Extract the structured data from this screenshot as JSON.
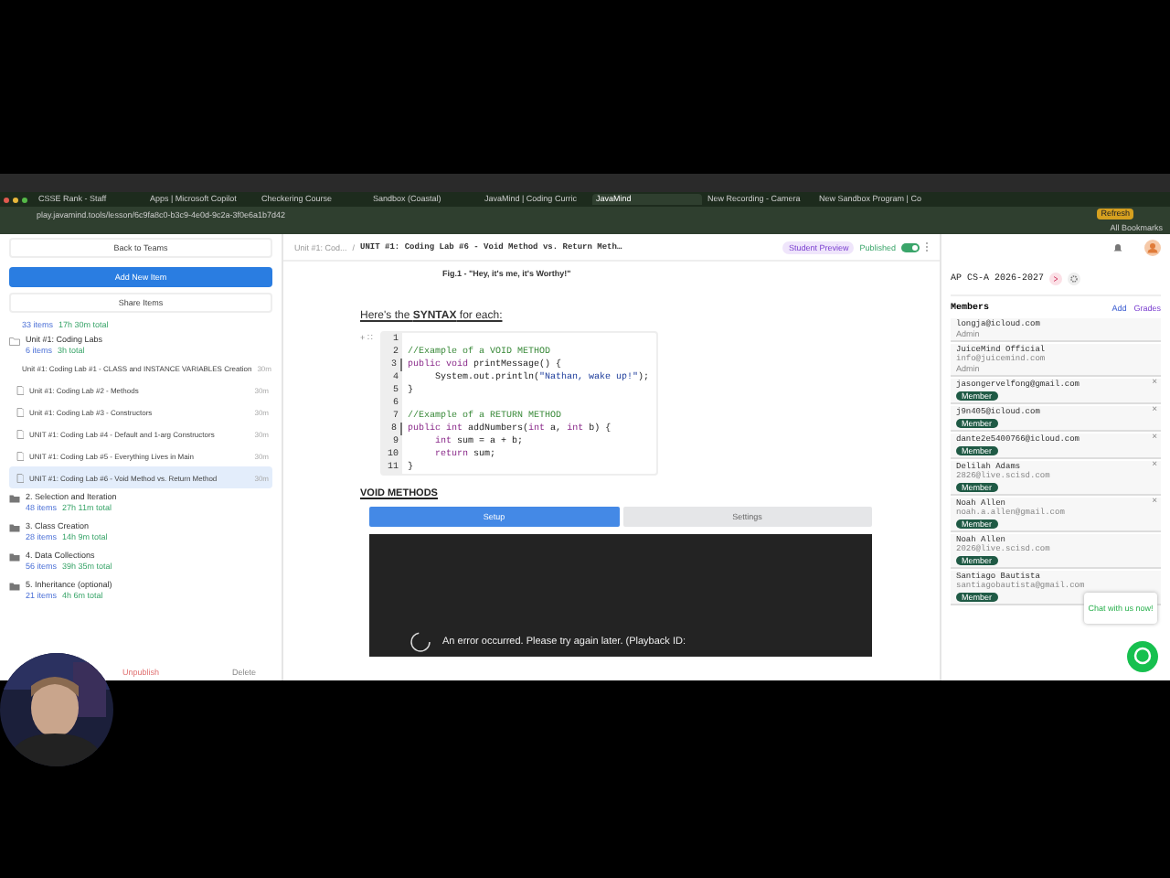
{
  "browser": {
    "tabs": [
      {
        "label": "CSSE Rank - Staff",
        "selected": false
      },
      {
        "label": "Apps | Microsoft Copilot",
        "selected": false
      },
      {
        "label": "Checkering Course",
        "selected": false
      },
      {
        "label": "Sandbox (Coastal)",
        "selected": false
      },
      {
        "label": "JavaMind | Coding Curric",
        "selected": false
      },
      {
        "label": "JavaMind",
        "selected": true
      },
      {
        "label": "New Recording - Camera",
        "selected": false
      },
      {
        "label": "New Sandbox Program | Co",
        "selected": false
      }
    ],
    "address": "play.javamind.tools/lesson/6c9fa8c0-b3c9-4e0d-9c2a-3f0e6a1b7d42",
    "profile": "Refresh",
    "bookmarks": "All Bookmarks"
  },
  "sidebar": {
    "back": "Back to Teams",
    "add": "Add New Item",
    "share": "Share Items",
    "summary": {
      "count": "33 items",
      "total": "17h 30m total"
    },
    "folders": [
      {
        "title": "Unit #1: Coding Labs",
        "count": "6 items",
        "total": "3h total",
        "expanded": true,
        "children": [
          {
            "title": "Unit #1: Coding Lab #1 - CLASS and INSTANCE VARIABLES Creation",
            "duration": "30m",
            "selected": false
          },
          {
            "title": "Unit #1: Coding Lab #2 - Methods",
            "duration": "30m",
            "selected": false
          },
          {
            "title": "Unit #1: Coding Lab #3 - Constructors",
            "duration": "30m",
            "selected": false
          },
          {
            "title": "UNIT #1: Coding Lab #4 - Default and 1-arg Constructors",
            "duration": "30m",
            "selected": false
          },
          {
            "title": "UNIT #1: Coding Lab #5 - Everything Lives in Main",
            "duration": "30m",
            "selected": false
          },
          {
            "title": "UNIT #1: Coding Lab #6 - Void Method vs. Return Method",
            "duration": "30m",
            "selected": true
          }
        ]
      },
      {
        "title": "2. Selection and Iteration",
        "count": "48 items",
        "total": "27h 11m total",
        "expanded": false
      },
      {
        "title": "3. Class Creation",
        "count": "28 items",
        "total": "14h 9m total",
        "expanded": false
      },
      {
        "title": "4. Data Collections",
        "count": "56 items",
        "total": "39h 35m total",
        "expanded": false
      },
      {
        "title": "5. Inheritance (optional)",
        "count": "21 items",
        "total": "4h 6m total",
        "expanded": false
      }
    ],
    "footer": [
      "Unpublish",
      "Delete"
    ]
  },
  "main": {
    "header": {
      "parent": "Unit #1: Cod...",
      "separator": "/",
      "title": "UNIT #1: Coding Lab #6 - Void Method vs. Return Meth…",
      "preview": "Student Preview",
      "published": "Published",
      "published_on": true
    },
    "caption": "Fig.1 - \"Hey, it's me, it's Worthy!\"",
    "syntax_heading": "Here's the **SYNTAX** for each:",
    "code": [
      {
        "num": "1",
        "fold": false
      },
      {
        "num": "2",
        "fold": false,
        "parts": [
          {
            "kind": "comment",
            "text": "//Example of a VOID METHOD"
          }
        ]
      },
      {
        "num": "3",
        "fold": true,
        "parts": [
          {
            "kind": "keyword",
            "text": "public void "
          },
          {
            "kind": "plain",
            "text": "printMessage() {"
          }
        ]
      },
      {
        "num": "4",
        "fold": false,
        "indented": true,
        "parts": [
          {
            "kind": "plain",
            "text": "System.out.println("
          },
          {
            "kind": "string",
            "text": "\"Nathan, wake up!\""
          },
          {
            "kind": "plain",
            "text": ");"
          }
        ]
      },
      {
        "num": "5",
        "fold": false,
        "parts": [
          {
            "kind": "plain",
            "text": "}"
          }
        ]
      },
      {
        "num": "6",
        "fold": false
      },
      {
        "num": "7",
        "fold": false,
        "parts": [
          {
            "kind": "comment",
            "text": "//Example of a RETURN METHOD"
          }
        ]
      },
      {
        "num": "8",
        "fold": true,
        "parts": [
          {
            "kind": "keyword",
            "text": "public int "
          },
          {
            "kind": "plain",
            "text": "addNumbers("
          },
          {
            "kind": "keyword",
            "text": "int "
          },
          {
            "kind": "plain",
            "text": "a, "
          },
          {
            "kind": "keyword",
            "text": "int "
          },
          {
            "kind": "plain",
            "text": "b) {"
          }
        ]
      },
      {
        "num": "9",
        "fold": false,
        "indented": true,
        "parts": [
          {
            "kind": "keyword",
            "text": "int "
          },
          {
            "kind": "plain",
            "text": "sum = a + b;"
          }
        ]
      },
      {
        "num": "10",
        "fold": false,
        "indented": true,
        "parts": [
          {
            "kind": "keyword",
            "text": "return "
          },
          {
            "kind": "plain",
            "text": "sum;"
          }
        ]
      },
      {
        "num": "11",
        "fold": false,
        "parts": [
          {
            "kind": "plain",
            "text": "}"
          }
        ]
      }
    ],
    "gutter_control": "+ ∷",
    "section_heading": "VOID METHODS",
    "video_tabs": [
      {
        "label": "Setup",
        "selected": true
      },
      {
        "label": "Settings",
        "selected": false
      }
    ],
    "video_error": "An error occurred. Please try again later. (Playback ID:"
  },
  "team": {
    "title": "AP CS-A 2026-2027",
    "members_heading": "Members",
    "add": "Add",
    "grades": "Grades",
    "members": [
      {
        "name": "longja@icloud.com",
        "role": "Admin",
        "kind": "admin"
      },
      {
        "name": "JuiceMind Official",
        "email": "info@juicemind.com",
        "role": "Admin",
        "kind": "admin"
      },
      {
        "name": "jasongervelfong@gmail.com",
        "role": "Member",
        "kind": "member",
        "remove": "×"
      },
      {
        "name": "j9n405@icloud.com",
        "role": "Member",
        "kind": "member",
        "remove": "×"
      },
      {
        "name": "dante2e5400766@icloud.com",
        "role": "Member",
        "kind": "member",
        "remove": "×"
      },
      {
        "name": "Delilah Adams",
        "email": "2826@live.scisd.com",
        "role": "Member",
        "kind": "member",
        "remove": "×"
      },
      {
        "name": "Noah Allen",
        "email": "noah.a.allen@gmail.com",
        "role": "Member",
        "kind": "member",
        "remove": "×"
      },
      {
        "name": "Noah Allen",
        "email": "2026@live.scisd.com",
        "role": "Member",
        "kind": "member"
      },
      {
        "name": "Santiago Bautista",
        "email": "santiagobautista@gmail.com",
        "role": "Member",
        "kind": "member"
      }
    ],
    "chat": "Chat with us now!"
  }
}
